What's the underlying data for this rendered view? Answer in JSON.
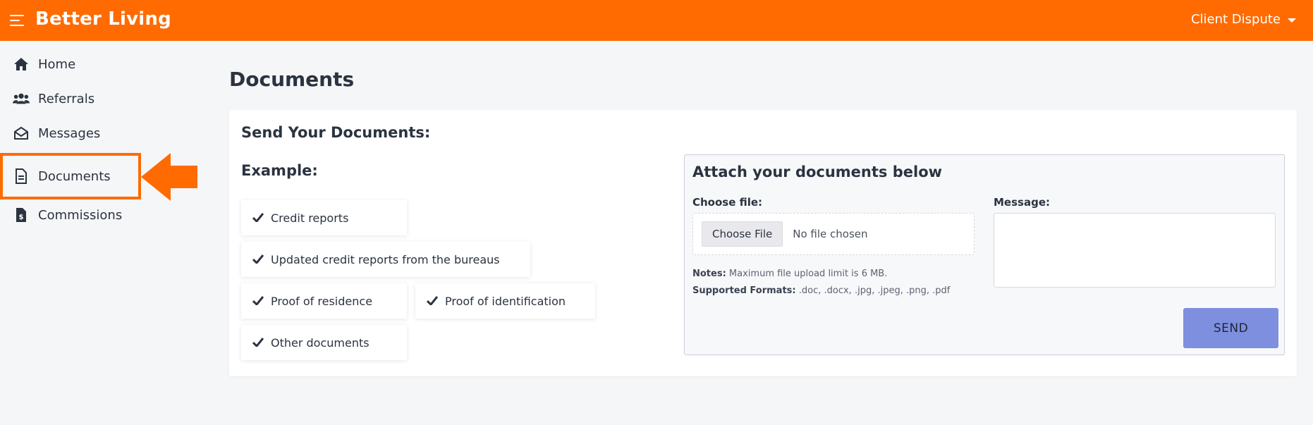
{
  "header": {
    "brand": "Better Living",
    "user_menu_label": "Client Dispute"
  },
  "sidebar": {
    "items": [
      {
        "label": "Home",
        "icon": "home-icon"
      },
      {
        "label": "Referrals",
        "icon": "users-icon"
      },
      {
        "label": "Messages",
        "icon": "envelope-open-icon"
      },
      {
        "label": "Documents",
        "icon": "document-icon",
        "active": true
      },
      {
        "label": "Commissions",
        "icon": "invoice-dollar-icon"
      }
    ]
  },
  "main": {
    "page_title": "Documents",
    "card_title": "Send Your Documents:",
    "example_title": "Example:",
    "examples": [
      "Credit reports",
      "Updated credit reports from the bureaus",
      "Proof of residence",
      "Proof of identification",
      "Other documents"
    ],
    "attach": {
      "title": "Attach your documents below",
      "choose_file_label": "Choose file:",
      "choose_file_button": "Choose File",
      "file_status": "No file chosen",
      "notes_label": "Notes:",
      "notes_text": "Maximum file upload limit is 6 MB.",
      "formats_label": "Supported Formats:",
      "formats_text": ".doc, .docx, .jpg, .jpeg, .png, .pdf",
      "message_label": "Message:",
      "message_value": "",
      "send_label": "SEND"
    }
  },
  "colors": {
    "brand": "#ff6b00",
    "send_button": "#7e8fe0",
    "page_bg": "#f5f6f8"
  }
}
